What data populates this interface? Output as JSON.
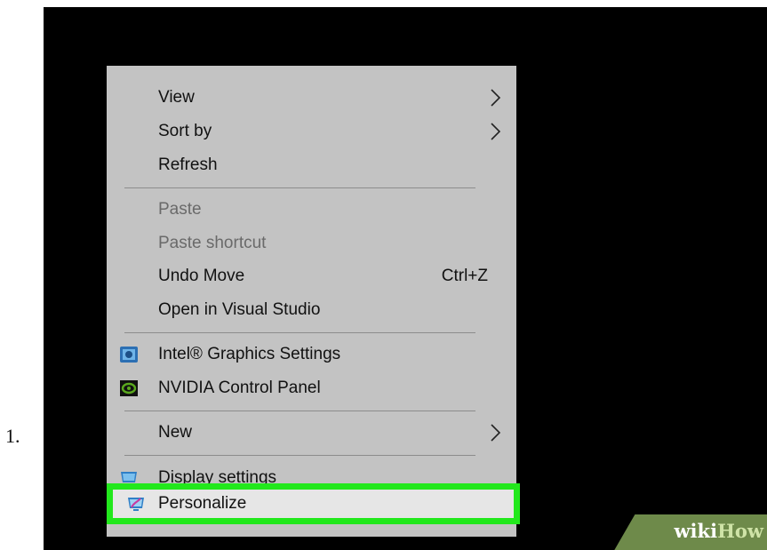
{
  "list_marker": "1.",
  "menu": {
    "items": [
      {
        "label": "View",
        "submenu": true
      },
      {
        "label": "Sort by",
        "submenu": true
      },
      {
        "label": "Refresh"
      },
      {
        "label": "Paste",
        "disabled": true
      },
      {
        "label": "Paste shortcut",
        "disabled": true
      },
      {
        "label": "Undo Move",
        "shortcut": "Ctrl+Z"
      },
      {
        "label": "Open in Visual Studio"
      },
      {
        "label": "Intel® Graphics Settings",
        "icon": "intel-graphics-icon"
      },
      {
        "label": "NVIDIA Control Panel",
        "icon": "nvidia-icon"
      },
      {
        "label": "New",
        "submenu": true
      },
      {
        "label": "Display settings",
        "icon": "display-icon"
      },
      {
        "label": "Personalize",
        "icon": "personalize-icon",
        "highlighted": true
      }
    ]
  },
  "highlight_color": "#22e81c",
  "watermark": {
    "wiki": "wiki",
    "how": "How"
  }
}
